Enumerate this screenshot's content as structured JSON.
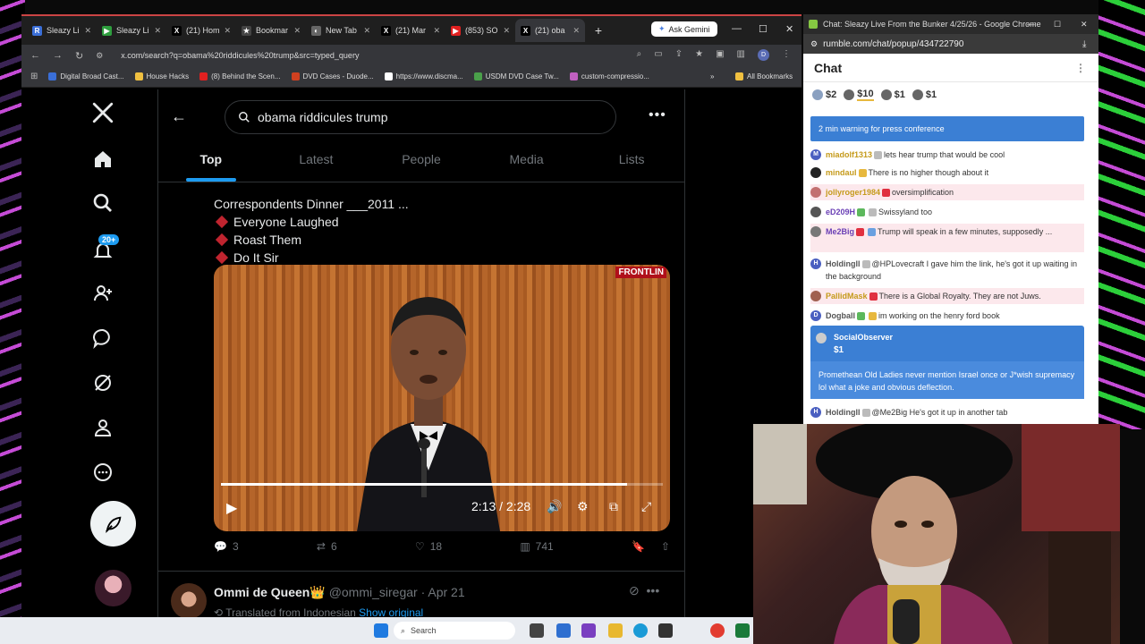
{
  "browser": {
    "tabs": [
      {
        "label": "Sleazy Li",
        "icon_color": "#3b6fd8",
        "icon_glyph": "R"
      },
      {
        "label": "Sleazy Li",
        "icon_color": "#2e9e3e",
        "icon_glyph": "▶"
      },
      {
        "label": "(21) Hom",
        "icon_color": "#000000",
        "icon_glyph": "X"
      },
      {
        "label": "Bookmar",
        "icon_color": "#444444",
        "icon_glyph": "★"
      },
      {
        "label": "New Tab",
        "icon_color": "#666666",
        "icon_glyph": "◐"
      },
      {
        "label": "(21) Mar",
        "icon_color": "#000000",
        "icon_glyph": "X"
      },
      {
        "label": "(853) SO",
        "icon_color": "#e02020",
        "icon_glyph": "▶"
      },
      {
        "label": "(21) oba",
        "icon_color": "#000000",
        "icon_glyph": "X"
      }
    ],
    "active_tab_index": 7,
    "new_tab_label": "+",
    "ask_gemini": "Ask Gemini",
    "url": "x.com/search?q=obama%20riddicules%20trump&src=typed_query",
    "profile_initial": "D",
    "bookmarks": [
      {
        "label": "Digital Broad Cast...",
        "color": "#3a6fd8"
      },
      {
        "label": "House Hacks",
        "color": "#f0c040"
      },
      {
        "label": "(8) Behind the Scen...",
        "color": "#e02020"
      },
      {
        "label": "DVD Cases - Duode...",
        "color": "#d04020"
      },
      {
        "label": "https://www.discma...",
        "color": "#ffffff"
      },
      {
        "label": "USDM DVD Case Tw...",
        "color": "#4aa04a"
      },
      {
        "label": "custom-compressio...",
        "color": "#c060c0"
      }
    ],
    "all_bookmarks": "All Bookmarks"
  },
  "x": {
    "search_query": "obama riddicules trump",
    "notif_badge": "20+",
    "tabs": [
      "Top",
      "Latest",
      "People",
      "Media",
      "Lists"
    ],
    "active_tab": "Top",
    "tweet_lines": {
      "first": "Correspondents Dinner ___2011 ...",
      "bullets": [
        "Everyone Laughed",
        "Roast Them",
        "Do It Sir"
      ]
    },
    "video": {
      "time": "2:13 / 2:28",
      "progress": 0.92,
      "brand": "FRONTLIN"
    },
    "actions": {
      "replies": "3",
      "reposts": "6",
      "likes": "18",
      "views": "741"
    },
    "next_tweet": {
      "name": "Ommi de Queen👑",
      "handle": "@ommi_siregar",
      "date": "· Apr 21",
      "translated": "Translated from Indonesian",
      "show_original": "Show original"
    }
  },
  "chat_window": {
    "title": "Chat: Sleazy Live From the Bunker 4/25/26 - Google Chrome",
    "url": "rumble.com/chat/popup/434722790",
    "header": "Chat",
    "tips": [
      "$2",
      "$10",
      "$1",
      "$1"
    ],
    "warning": "2 min warning for press conference",
    "messages": [
      {
        "user": "miadolf1313",
        "text": "lets hear trump that would be cool",
        "user_color": "#c59a1a",
        "av_color": "#4a5fc0",
        "av_letter": "M",
        "pink": false
      },
      {
        "user": "mindaul",
        "text": "There is no higher though about it",
        "user_color": "#c59a1a",
        "av_color": "#222222",
        "av_letter": "",
        "pink": false
      },
      {
        "user": "jollyroger1984",
        "text": "oversimplification",
        "user_color": "#c59a1a",
        "av_color": "#c27070",
        "av_letter": "",
        "pink": true
      },
      {
        "user": "eD209H",
        "text": "Swissyland too",
        "user_color": "#6a3fb5",
        "av_color": "#555555",
        "av_letter": "",
        "pink": false
      },
      {
        "user": "Me2Big",
        "text": "Trump will speak in a few minutes, supposedly ...",
        "user_color": "#6a3fb5",
        "av_color": "#777777",
        "av_letter": "",
        "pink": true
      },
      {
        "user": "Holdingll",
        "text": "@HPLovecraft I gave him the link, he's got it up waiting in the background",
        "user_color": "#555555",
        "av_color": "#4a5fc0",
        "av_letter": "H",
        "pink": false
      },
      {
        "user": "PallidMask",
        "text": "There is a Global Royalty. They are not Juws.",
        "user_color": "#c59a1a",
        "av_color": "#a06050",
        "av_letter": "",
        "pink": true
      },
      {
        "user": "Dogball",
        "text": "im working on the henry ford book",
        "user_color": "#555555",
        "av_color": "#4a5fc0",
        "av_letter": "D",
        "pink": false
      }
    ],
    "superchat": {
      "user": "SocialObserver",
      "amount": "$1",
      "text": "Promethean Old Ladies never mention Israel once or J*wish supremacy lol what a joke and obvious deflection."
    },
    "last_message": {
      "user": "Holdingll",
      "text": "@Me2Big He's got it up in another tab",
      "av_letter": "H"
    }
  },
  "taskbar": {
    "search": "Search"
  },
  "colors": {
    "x_blue": "#1d9bf0",
    "rumble_blue": "#3b7fd4",
    "x_text": "#e7e9ea",
    "x_muted": "#71767b"
  }
}
